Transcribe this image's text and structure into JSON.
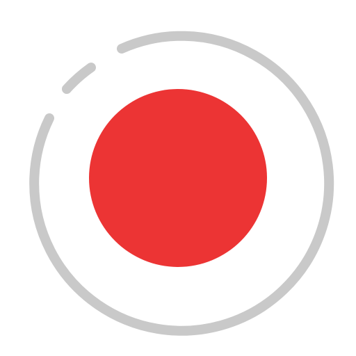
{
  "icon": {
    "name": "record-icon",
    "ring_color": "#c9c9c9",
    "dot_color": "#ec3434",
    "background": "#ffffff"
  }
}
